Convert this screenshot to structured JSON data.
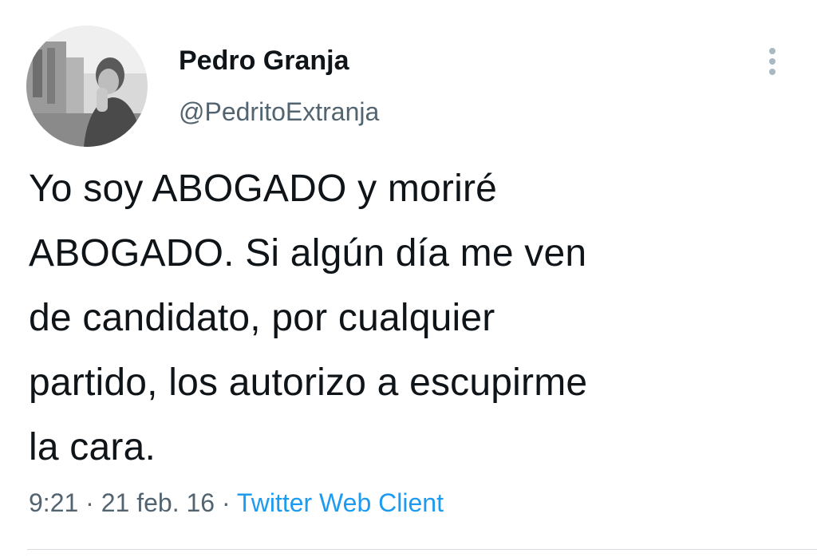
{
  "tweet": {
    "author": {
      "display_name": "Pedro Granja",
      "handle": "@PedritoExtranja"
    },
    "text_lines": [
      "Yo soy ABOGADO y moriré",
      "ABOGADO. Si algún día me ven",
      "de candidato, por cualquier",
      "partido, los autorizo a escupirme",
      "la cara."
    ],
    "time": "9:21",
    "date": "21 feb. 16",
    "separator": "·",
    "source": "Twitter Web Client",
    "more_icon": "vertical-ellipsis-icon"
  },
  "colors": {
    "text": "#0f1419",
    "secondary": "#536471",
    "link": "#1d9bf0"
  }
}
